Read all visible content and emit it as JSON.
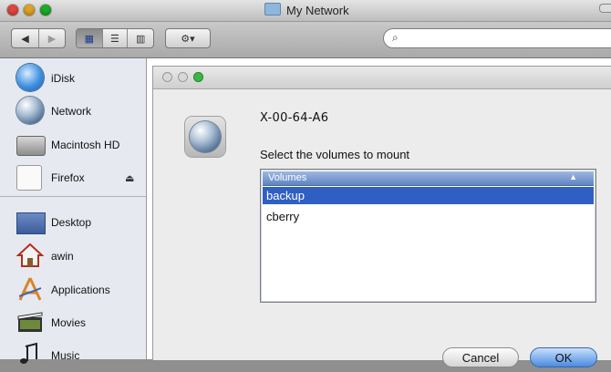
{
  "window": {
    "title": "My Network",
    "traffic_colors": [
      "#e0443e",
      "#dea123",
      "#1aab29"
    ]
  },
  "toolbar": {
    "back_icon": "back-arrow-icon",
    "forward_icon": "forward-arrow-icon",
    "view_icons": [
      "icon-view-icon",
      "list-view-icon",
      "column-view-icon"
    ],
    "action_icon": "gear-icon",
    "search_placeholder": ""
  },
  "sidebar": {
    "devices": [
      {
        "label": "iDisk",
        "icon": "idisk-icon"
      },
      {
        "label": "Network",
        "icon": "network-globe-icon"
      },
      {
        "label": "Macintosh HD",
        "icon": "hard-disk-icon"
      },
      {
        "label": "Firefox",
        "icon": "disk-image-icon",
        "eject": "⏏"
      }
    ],
    "places": [
      {
        "label": "Desktop",
        "icon": "desktop-icon"
      },
      {
        "label": "awin",
        "icon": "home-icon"
      },
      {
        "label": "Applications",
        "icon": "applications-icon"
      },
      {
        "label": "Movies",
        "icon": "movies-icon"
      },
      {
        "label": "Music",
        "icon": "music-icon"
      }
    ]
  },
  "dialog": {
    "server_name": "X-00-64-A6",
    "prompt": "Select the volumes to mount",
    "column_header": "Volumes",
    "volumes": [
      {
        "name": "backup",
        "selected": true
      },
      {
        "name": "cberry",
        "selected": false
      }
    ],
    "cancel_label": "Cancel",
    "ok_label": "OK"
  }
}
